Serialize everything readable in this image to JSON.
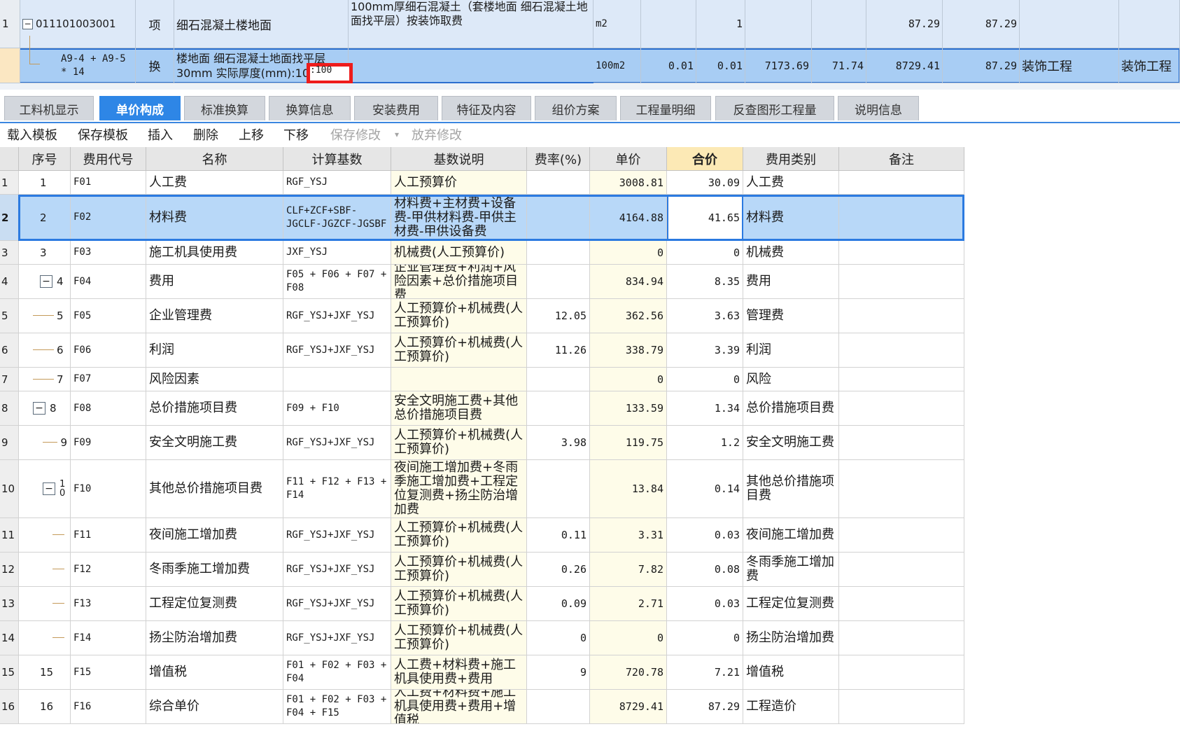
{
  "top_rows": [
    {
      "index": "1",
      "code": "011101003001",
      "category": "项",
      "name": "细石混凝土楼地面",
      "feature": "100mm厚细石混凝土（套楼地面 细石混凝土地面找平层）按装饰取费",
      "unit": "m2",
      "qty_expr": "",
      "qty": "1",
      "unit_price": "",
      "price2": "",
      "total": "87.29",
      "total2": "87.29",
      "specialty": "",
      "specialty2": ""
    },
    {
      "index": "",
      "code": "A9-4 + A9-5 * 14",
      "category": "换",
      "name": "楼地面 细石混凝土地面找平层 30mm  实际厚度(mm):100",
      "feature": "",
      "unit": "100m2",
      "qty_expr": "0.01",
      "qty": "0.01",
      "unit_price": "7173.69",
      "price2": "71.74",
      "total": "8729.41",
      "total2": "87.29",
      "specialty": "装饰工程",
      "specialty2": "装饰工程"
    }
  ],
  "edit_value": ":100",
  "tabs": [
    "工料机显示",
    "单价构成",
    "标准换算",
    "换算信息",
    "安装费用",
    "特征及内容",
    "组价方案",
    "工程量明细",
    "反查图形工程量",
    "说明信息"
  ],
  "toolbar": {
    "load_template": "载入模板",
    "save_template": "保存模板",
    "insert": "插入",
    "delete": "删除",
    "move_up": "上移",
    "move_down": "下移",
    "save_changes": "保存修改",
    "discard_changes": "放弃修改"
  },
  "grid_headers": [
    "",
    "序号",
    "费用代号",
    "名称",
    "计算基数",
    "基数说明",
    "费率(%)",
    "单价",
    "合价",
    "费用类别",
    "备注"
  ],
  "grid_rows": [
    {
      "row": "1",
      "seq": "1",
      "code": "F01",
      "name": "人工费",
      "base": "RGF_YSJ",
      "desc": "人工预算价",
      "rate": "",
      "price": "3008.81",
      "total": "30.09",
      "category": "人工费",
      "note": ""
    },
    {
      "row": "2",
      "seq": "2",
      "code": "F02",
      "name": "材料费",
      "base": "CLF+ZCF+SBF-JGCLF-JGZCF-JGSBF",
      "desc": "材料费+主材费+设备费-甲供材料费-甲供主材费-甲供设备费",
      "rate": "",
      "price": "4164.88",
      "total": "41.65",
      "category": "材料费",
      "note": ""
    },
    {
      "row": "3",
      "seq": "3",
      "code": "F03",
      "name": "施工机具使用费",
      "base": "JXF_YSJ",
      "desc": "机械费(人工预算价)",
      "rate": "",
      "price": "0",
      "total": "0",
      "category": "机械费",
      "note": ""
    },
    {
      "row": "4",
      "seq": "4",
      "code": "F04",
      "name": "费用",
      "base": "F05 + F06 + F07 + F08",
      "desc": "企业管理费+利润+风险因素+总价措施项目费",
      "rate": "",
      "price": "834.94",
      "total": "8.35",
      "category": "费用",
      "note": ""
    },
    {
      "row": "5",
      "seq": "5",
      "code": "F05",
      "name": "企业管理费",
      "base": "RGF_YSJ+JXF_YSJ",
      "desc": "人工预算价+机械费(人工预算价)",
      "rate": "12.05",
      "price": "362.56",
      "total": "3.63",
      "category": "管理费",
      "note": ""
    },
    {
      "row": "6",
      "seq": "6",
      "code": "F06",
      "name": "利润",
      "base": "RGF_YSJ+JXF_YSJ",
      "desc": "人工预算价+机械费(人工预算价)",
      "rate": "11.26",
      "price": "338.79",
      "total": "3.39",
      "category": "利润",
      "note": ""
    },
    {
      "row": "7",
      "seq": "7",
      "code": "F07",
      "name": "风险因素",
      "base": "",
      "desc": "",
      "rate": "",
      "price": "0",
      "total": "0",
      "category": "风险",
      "note": ""
    },
    {
      "row": "8",
      "seq": "8",
      "code": "F08",
      "name": "总价措施项目费",
      "base": "F09 + F10",
      "desc": "安全文明施工费+其他总价措施项目费",
      "rate": "",
      "price": "133.59",
      "total": "1.34",
      "category": "总价措施项目费",
      "note": ""
    },
    {
      "row": "9",
      "seq": "9",
      "code": "F09",
      "name": "安全文明施工费",
      "base": "RGF_YSJ+JXF_YSJ",
      "desc": "人工预算价+机械费(人工预算价)",
      "rate": "3.98",
      "price": "119.75",
      "total": "1.2",
      "category": "安全文明施工费",
      "note": ""
    },
    {
      "row": "10",
      "seq": "10",
      "code": "F10",
      "name": "其他总价措施项目费",
      "base": "F11 + F12 + F13 + F14",
      "desc": "夜间施工增加费+冬雨季施工增加费+工程定位复测费+扬尘防治增加费",
      "rate": "",
      "price": "13.84",
      "total": "0.14",
      "category": "其他总价措施项目费",
      "note": ""
    },
    {
      "row": "11",
      "seq": "",
      "code": "F11",
      "name": "夜间施工增加费",
      "base": "RGF_YSJ+JXF_YSJ",
      "desc": "人工预算价+机械费(人工预算价)",
      "rate": "0.11",
      "price": "3.31",
      "total": "0.03",
      "category": "夜间施工增加费",
      "note": ""
    },
    {
      "row": "12",
      "seq": "",
      "code": "F12",
      "name": "冬雨季施工增加费",
      "base": "RGF_YSJ+JXF_YSJ",
      "desc": "人工预算价+机械费(人工预算价)",
      "rate": "0.26",
      "price": "7.82",
      "total": "0.08",
      "category": "冬雨季施工增加费",
      "note": ""
    },
    {
      "row": "13",
      "seq": "",
      "code": "F13",
      "name": "工程定位复测费",
      "base": "RGF_YSJ+JXF_YSJ",
      "desc": "人工预算价+机械费(人工预算价)",
      "rate": "0.09",
      "price": "2.71",
      "total": "0.03",
      "category": "工程定位复测费",
      "note": ""
    },
    {
      "row": "14",
      "seq": "",
      "code": "F14",
      "name": "扬尘防治增加费",
      "base": "RGF_YSJ+JXF_YSJ",
      "desc": "人工预算价+机械费(人工预算价)",
      "rate": "0",
      "price": "0",
      "total": "0",
      "category": "扬尘防治增加费",
      "note": ""
    },
    {
      "row": "15",
      "seq": "15",
      "code": "F15",
      "name": "增值税",
      "base": "F01 + F02 + F03 + F04",
      "desc": "人工费+材料费+施工机具使用费+费用",
      "rate": "9",
      "price": "720.78",
      "total": "7.21",
      "category": "增值税",
      "note": ""
    },
    {
      "row": "16",
      "seq": "16",
      "code": "F16",
      "name": "综合单价",
      "base": "F01 + F02 + F03 + F04 + F15",
      "desc": "人工费+材料费+施工机具使用费+费用+增值税",
      "rate": "",
      "price": "8729.41",
      "total": "87.29",
      "category": "工程造价",
      "note": ""
    }
  ]
}
